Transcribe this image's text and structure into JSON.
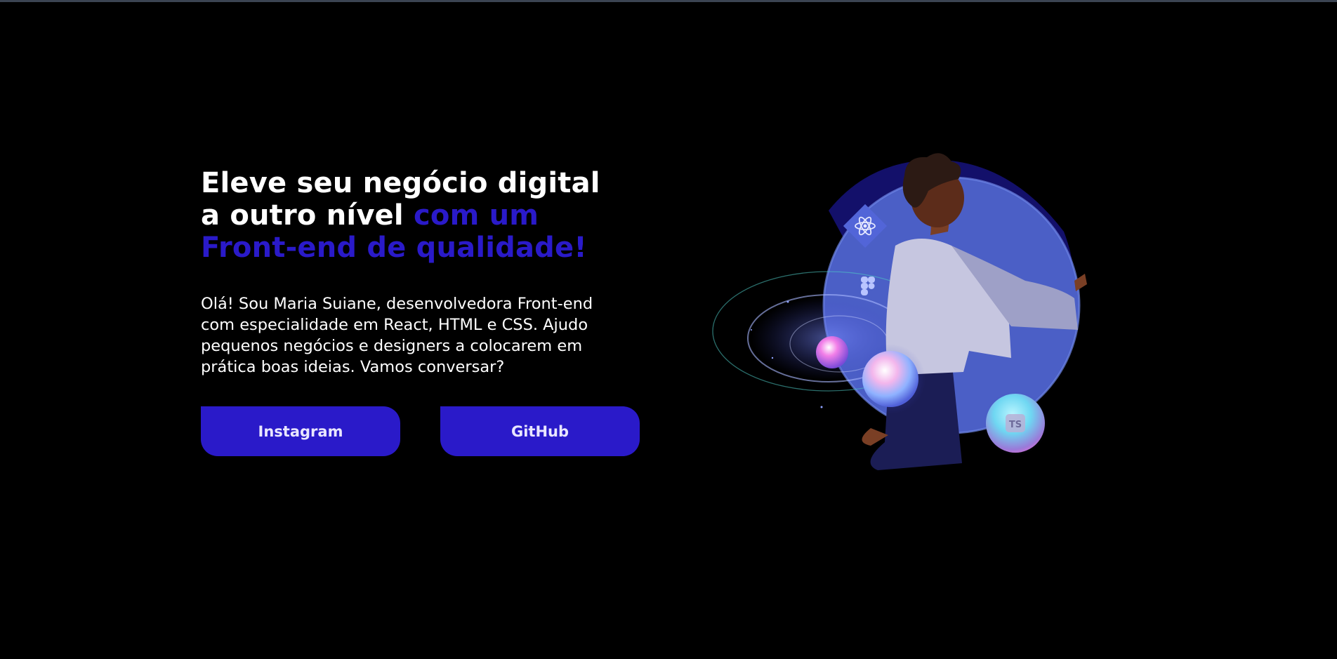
{
  "hero": {
    "headline_line1": "Eleve seu negócio digital",
    "headline_line2_white": "a outro nível",
    "headline_line2_accent": "com um",
    "headline_line3_accent": "Front-end de qualidade!",
    "intro_line1": "Olá! Sou Maria Suiane, desenvolvedora Front-end",
    "intro_line2": "com especialidade em React, HTML e CSS. Ajudo",
    "intro_line3": "pequenos negócios e designers a colocarem em",
    "intro_line4": "prática boas ideias. Vamos conversar?"
  },
  "buttons": {
    "instagram_label": "Instagram",
    "github_label": "GitHub"
  },
  "illustration": {
    "ts_badge": "TS",
    "icons": [
      "react-icon",
      "figma-icon",
      "typescript-icon"
    ]
  },
  "colors": {
    "background": "#000000",
    "accent": "#2a1ac9",
    "text": "#ffffff",
    "button_text": "#e9e6ff"
  }
}
